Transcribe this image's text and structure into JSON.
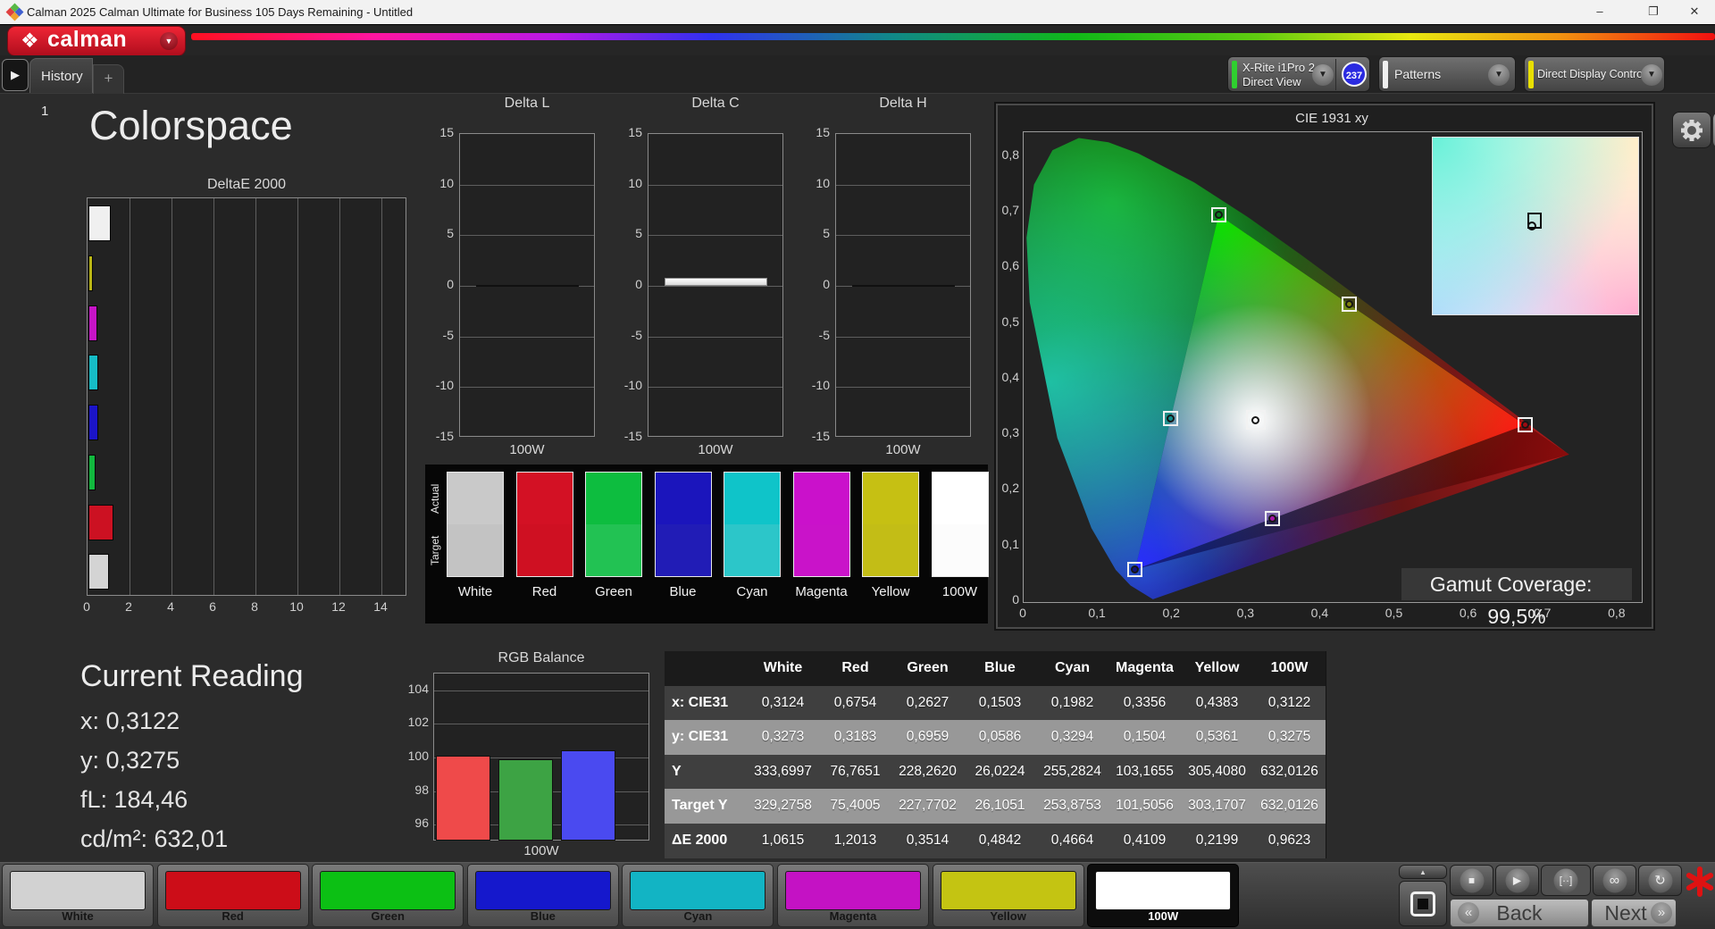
{
  "window": {
    "title": "Calman 2025 Calman Ultimate for Business 105 Days Remaining  - Untitled",
    "minimize": "–",
    "maximize": "❐",
    "close": "✕"
  },
  "header": {
    "logo_text": "calman",
    "logo_diamond": "❖",
    "tab_history": "History 1",
    "tab_add": "+",
    "meter": {
      "line1": "X-Rite i1Pro 2",
      "line2": "Direct View",
      "badge": "237",
      "stripe_color": "#2fd02f"
    },
    "patterns": {
      "label": "Patterns",
      "stripe_color": "#f0f0f0"
    },
    "display_control": {
      "label": "Direct Display Control",
      "stripe_color": "#e8df00"
    }
  },
  "page_title": "Colorspace",
  "reading": {
    "title": "Current Reading",
    "lines": [
      "x: 0,3122",
      "y: 0,3275",
      "fL: 184,46",
      "cd/m²: 632,01"
    ]
  },
  "chart_data": [
    {
      "id": "deltae2000",
      "type": "bar",
      "orientation": "horizontal",
      "title": "DeltaE 2000",
      "categories": [
        "White",
        "Yellow",
        "Magenta",
        "Cyan",
        "Blue",
        "Green",
        "Red",
        "100W"
      ],
      "values": [
        1.0615,
        0.2199,
        0.4109,
        0.4664,
        0.4842,
        0.3514,
        1.2013,
        0.9623
      ],
      "colors": [
        "#f0f0f0",
        "#b9b514",
        "#c714c7",
        "#16bcc6",
        "#1b14c8",
        "#12b83e",
        "#cc1122",
        "#d4d4d4"
      ],
      "xlim": [
        0,
        14
      ],
      "x_ticks": [
        0,
        2,
        4,
        6,
        8,
        10,
        12,
        14
      ],
      "grid": true
    },
    {
      "id": "delta_l",
      "type": "bar",
      "title": "Delta L",
      "categories": [
        "100W"
      ],
      "values": [
        0
      ],
      "ylim": [
        -15,
        15
      ],
      "y_ticks": [
        "15",
        "10",
        "5",
        "0",
        "-5",
        "-10",
        "-15"
      ],
      "xlabel": "100W",
      "grid": true
    },
    {
      "id": "delta_c",
      "type": "bar",
      "title": "Delta C",
      "categories": [
        "100W"
      ],
      "values": [
        0.8
      ],
      "ylim": [
        -15,
        15
      ],
      "y_ticks": [
        "15",
        "10",
        "5",
        "0",
        "-5",
        "-10",
        "-15"
      ],
      "xlabel": "100W",
      "grid": true
    },
    {
      "id": "delta_h",
      "type": "bar",
      "title": "Delta H",
      "categories": [
        "100W"
      ],
      "values": [
        0
      ],
      "ylim": [
        -15,
        15
      ],
      "y_ticks": [
        "15",
        "10",
        "5",
        "0",
        "-5",
        "-10",
        "-15"
      ],
      "xlabel": "100W",
      "grid": true
    },
    {
      "id": "rgb_balance",
      "type": "bar",
      "title": "RGB Balance",
      "categories": [
        "Red",
        "Green",
        "Blue"
      ],
      "values": [
        100.1,
        99.9,
        100.45
      ],
      "colors": [
        "#ef4a4a",
        "#3da344",
        "#4a4af0"
      ],
      "ylim": [
        95,
        105
      ],
      "y_ticks": [
        104,
        102,
        100,
        98,
        96
      ],
      "xlabel": "100W",
      "grid": true
    },
    {
      "id": "cie1931",
      "type": "scatter",
      "title": "CIE 1931 xy",
      "xlim": [
        0,
        0.83
      ],
      "ylim": [
        0,
        0.84
      ],
      "x_ticks": [
        "0",
        "0,1",
        "0,2",
        "0,3",
        "0,4",
        "0,5",
        "0,6",
        "0,7",
        "0,8"
      ],
      "y_ticks": [
        "0",
        "0,1",
        "0,2",
        "0,3",
        "0,4",
        "0,5",
        "0,6",
        "0,7",
        "0,8"
      ],
      "points": [
        {
          "name": "White",
          "x": 0.3124,
          "y": 0.3273,
          "dot": "none"
        },
        {
          "name": "Red",
          "x": 0.6754,
          "y": 0.3183,
          "dot": "#9c0b12"
        },
        {
          "name": "Green",
          "x": 0.2627,
          "y": 0.6959,
          "dot": "#0b7a22"
        },
        {
          "name": "Blue",
          "x": 0.1503,
          "y": 0.0586,
          "dot": "#10127a"
        },
        {
          "name": "Cyan",
          "x": 0.1982,
          "y": 0.3294,
          "dot": "#0c8a8a"
        },
        {
          "name": "Magenta",
          "x": 0.3356,
          "y": 0.1504,
          "dot": "#a812a8"
        },
        {
          "name": "Yellow",
          "x": 0.4383,
          "y": 0.5361,
          "dot": "#83830e"
        }
      ],
      "gamut_triangle": {
        "red": [
          0.6754,
          0.3183
        ],
        "green": [
          0.2627,
          0.6959
        ],
        "blue": [
          0.1503,
          0.0586
        ]
      },
      "coverage_label": "Gamut Coverage:",
      "coverage_value": "99,5%"
    }
  ],
  "swatch_panel": {
    "row_labels": [
      "Actual",
      "Target"
    ],
    "columns": [
      {
        "name": "White",
        "actual": "#c9c9c9",
        "target": "#c3c3c3"
      },
      {
        "name": "Red",
        "actual": "#d31124",
        "target": "#cf1022"
      },
      {
        "name": "Green",
        "actual": "#0dbd3f",
        "target": "#22c253"
      },
      {
        "name": "Blue",
        "actual": "#1b15bc",
        "target": "#211cb6"
      },
      {
        "name": "Cyan",
        "actual": "#0fc4c9",
        "target": "#2cc6c9"
      },
      {
        "name": "Magenta",
        "actual": "#ca11cb",
        "target": "#c913c9"
      },
      {
        "name": "Yellow",
        "actual": "#c6c013",
        "target": "#c3bd16"
      },
      {
        "name": "100W",
        "actual": "#ffffff",
        "target": "#fcfcfc"
      }
    ]
  },
  "table": {
    "headers": [
      "",
      "White",
      "Red",
      "Green",
      "Blue",
      "Cyan",
      "Magenta",
      "Yellow",
      "100W"
    ],
    "rows": [
      {
        "label": "x: CIE31",
        "values": [
          "0,3124",
          "0,6754",
          "0,2627",
          "0,1503",
          "0,1982",
          "0,3356",
          "0,4383",
          "0,3122"
        ]
      },
      {
        "label": "y: CIE31",
        "values": [
          "0,3273",
          "0,3183",
          "0,6959",
          "0,0586",
          "0,3294",
          "0,1504",
          "0,5361",
          "0,3275"
        ]
      },
      {
        "label": "Y",
        "values": [
          "333,6997",
          "76,7651",
          "228,2620",
          "26,0224",
          "255,2824",
          "103,1655",
          "305,4080",
          "632,0126"
        ]
      },
      {
        "label": "Target Y",
        "values": [
          "329,2758",
          "75,4005",
          "227,7702",
          "26,1051",
          "253,8753",
          "101,5056",
          "303,1707",
          "632,0126"
        ]
      },
      {
        "label": "ΔE 2000",
        "values": [
          "1,0615",
          "1,2013",
          "0,3514",
          "0,4842",
          "0,4664",
          "0,4109",
          "0,2199",
          "0,9623"
        ]
      }
    ]
  },
  "footer": {
    "items": [
      {
        "label": "White",
        "color": "#d2d2d2",
        "selected": false
      },
      {
        "label": "Red",
        "color": "#cc0d18",
        "selected": false
      },
      {
        "label": "Green",
        "color": "#0cc014",
        "selected": false
      },
      {
        "label": "Blue",
        "color": "#1518cc",
        "selected": false
      },
      {
        "label": "Cyan",
        "color": "#12b4c4",
        "selected": false
      },
      {
        "label": "Magenta",
        "color": "#c412c4",
        "selected": false
      },
      {
        "label": "Yellow",
        "color": "#c4c412",
        "selected": false
      },
      {
        "label": "100W",
        "color": "#ffffff",
        "selected": true
      }
    ]
  },
  "transport": {
    "back": "Back",
    "next": "Next",
    "back_chevron": "«",
    "next_chevron": "»",
    "stop": "■",
    "play": "▶",
    "measure": "[··]",
    "loop": "∞",
    "refresh": "↻",
    "chevron_up": "▲"
  }
}
